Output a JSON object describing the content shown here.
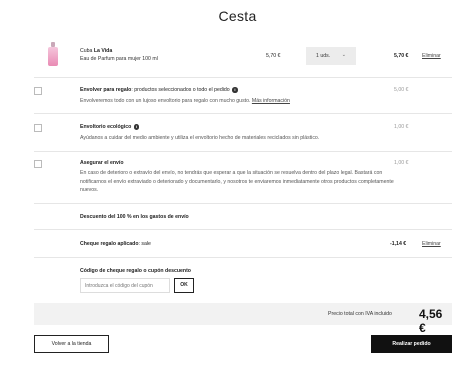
{
  "page": {
    "title": "Cesta"
  },
  "product": {
    "name_prefix": "Cuba",
    "name_bold": "La Vida",
    "description": "Eau de Parfum para mujer 100 ml",
    "unit_price": "5,70 €",
    "quantity": "1 uds.",
    "line_total": "5,70 €",
    "remove_label": "Eliminar"
  },
  "gift_wrap": {
    "title_bold": "Envolver para regalo",
    "title_rest": ": productos seleccionados o todo el pedido",
    "description": "Envolveremos todo con un lujoso envoltorio para regalo con mucho gusto.",
    "more_link": "Más información",
    "price": "5,00 €",
    "checked": false
  },
  "eco_wrap": {
    "title_bold": "Envoltorio ecológico",
    "description": "Ayúdanos a cuidar del medio ambiente y utiliza el envoltorio hecho de materiales reciclados sin plástico.",
    "price": "1,00 €",
    "checked": false
  },
  "insurance": {
    "title_bold": "Asegurar el envío",
    "description": "En caso de deterioro o extravío del envío, no tendrás que esperar a que la situación se resuelva dentro del plazo legal. Bastará con notificarnos el envío extraviado o deteriorado y documentarlo, y nosotros te enviaremos inmediatamente otros productos completamente nuevos.",
    "price": "1,00 €",
    "checked": false
  },
  "shipping_discount": {
    "label": "Descuento del 100 % en los gastos de envío"
  },
  "gift_cheque": {
    "label_bold": "Cheque regalo aplicado",
    "label_value": ": sale",
    "amount": "-1,14 €",
    "remove_label": "Eliminar"
  },
  "coupon": {
    "label": "Código de cheque regalo o cupón descuento",
    "placeholder": "Introduzca el código del cupón",
    "button_label": "OK"
  },
  "total": {
    "label": "Precio total con IVA incluido",
    "amount": "4,56 €"
  },
  "actions": {
    "back_label": "Volver a la tienda",
    "checkout_label": "Realizar pedido"
  },
  "icons": {
    "info": "info-icon",
    "chevron": "chevron-down-icon",
    "product_image": "perfume-bottle"
  },
  "colors": {
    "accent": "#111111",
    "total_bar": "#f2f2f2",
    "select_bg": "#ececec"
  }
}
